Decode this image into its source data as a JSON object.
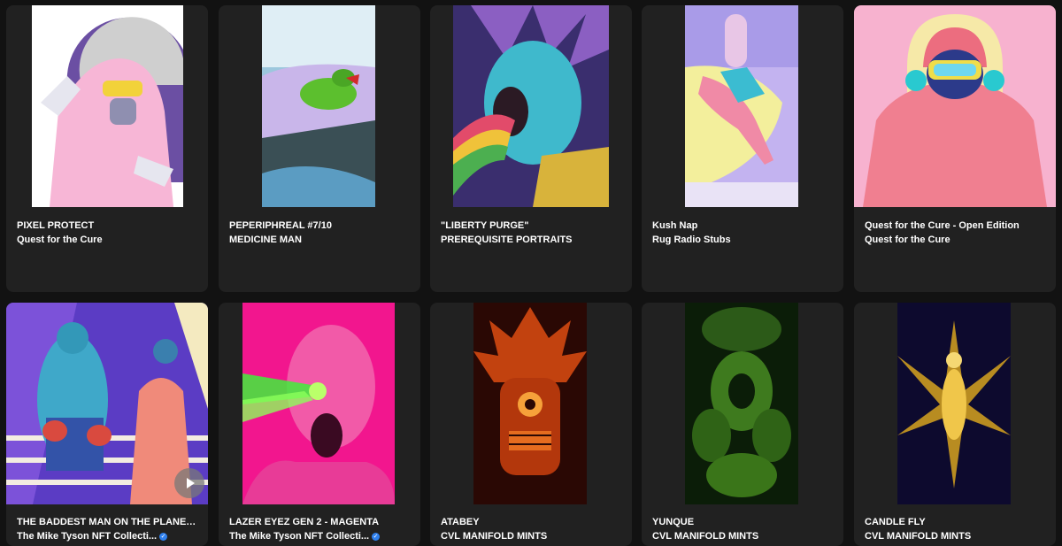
{
  "cards": [
    {
      "title": "PIXEL PROTECT",
      "collection": "Quest for the Cure",
      "verified": false
    },
    {
      "title": "PEPERIPHREAL #7/10",
      "collection": "MEDICINE MAN",
      "verified": false
    },
    {
      "title": "\"LIBERTY PURGE\"",
      "collection": "PREREQUISITE PORTRAITS",
      "verified": false
    },
    {
      "title": "Kush Nap",
      "collection": "Rug Radio Stubs",
      "verified": false
    },
    {
      "title": "Quest for the Cure - Open Edition",
      "collection": "Quest for the Cure",
      "verified": false
    },
    {
      "title": "THE BADDEST MAN ON THE PLANET E...",
      "collection": "The Mike Tyson NFT Collecti...",
      "verified": true,
      "video": true
    },
    {
      "title": "LAZER EYEZ GEN 2 - MAGENTA",
      "collection": "The Mike Tyson NFT Collecti...",
      "verified": true
    },
    {
      "title": "ATABEY",
      "collection": "CVL MANIFOLD MINTS",
      "verified": false
    },
    {
      "title": "YUNQUE",
      "collection": "CVL MANIFOLD MINTS",
      "verified": false
    },
    {
      "title": "CANDLE FLY",
      "collection": "CVL MANIFOLD MINTS",
      "verified": false
    }
  ],
  "icons": {
    "verified": "verified-badge-icon",
    "play": "play-icon"
  },
  "colors": {
    "page_bg": "#121212",
    "card_bg": "#212121",
    "text": "#ffffff",
    "verified": "#2f80ed"
  }
}
